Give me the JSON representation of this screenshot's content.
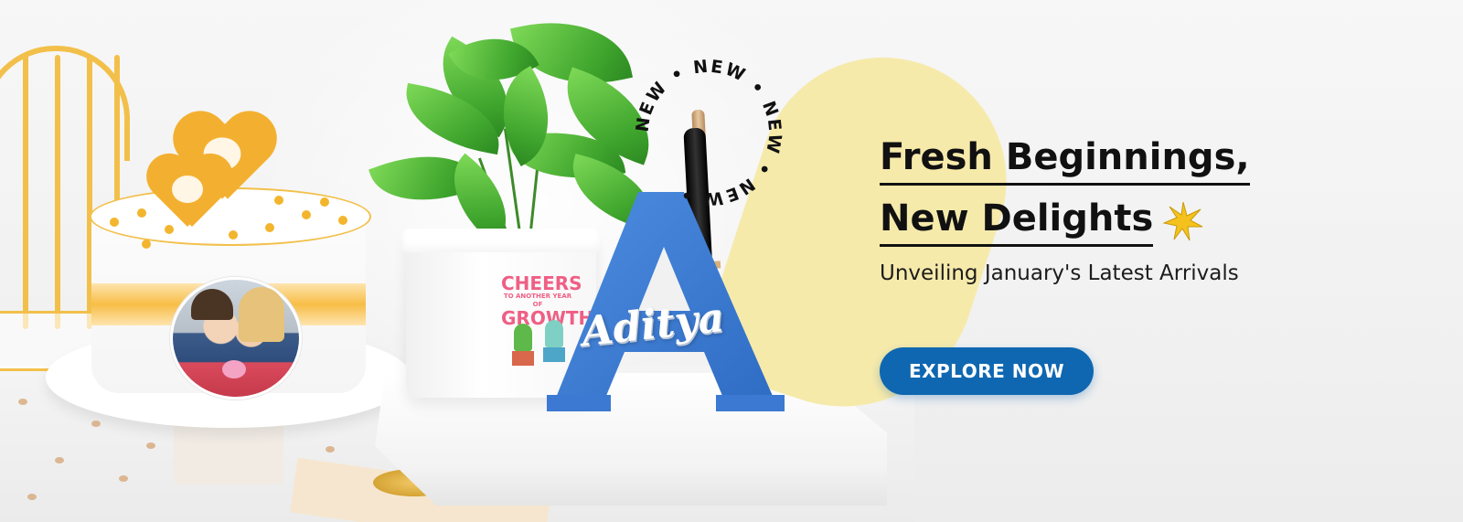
{
  "banner": {
    "headline_line1": "Fresh Beginnings,",
    "headline_line2": "New Delights",
    "subheading": "Unveiling January's Latest Arrivals",
    "cta_label": "EXPLORE NOW",
    "badge_text": "NEW • NEW • NEW • NEW •",
    "personalised_name": "Aditya",
    "pot_print": {
      "line1": "CHEERS",
      "line2": "TO ANOTHER YEAR OF",
      "line3": "GROWTH"
    },
    "icons": [
      "sparkle-icon"
    ]
  },
  "colors": {
    "cta_background": "#0f67b1",
    "cta_text": "#ffffff",
    "headline": "#111111",
    "accent_yellow": "#f6e9a7",
    "letter_blue": "#3f7fd6",
    "cake_gold": "#f3b030"
  }
}
